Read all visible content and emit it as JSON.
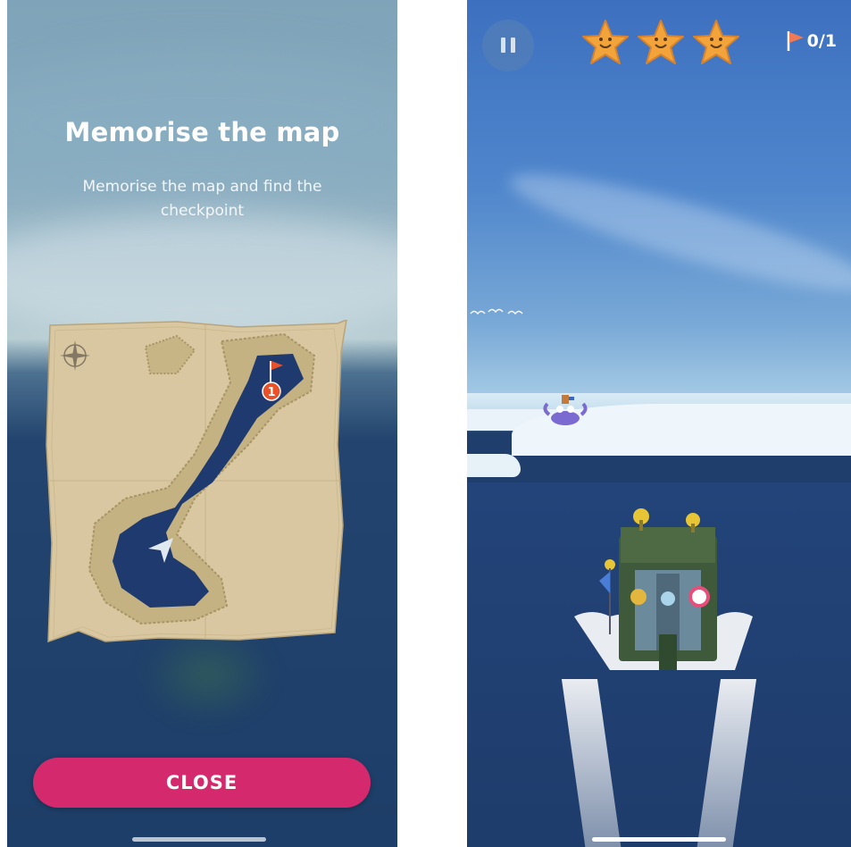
{
  "left_screen": {
    "title": "Memorise the map",
    "subtitle": "Memorise the map and find the checkpoint",
    "checkpoint_badge": "1",
    "close_label": "CLOSE"
  },
  "right_screen": {
    "stars_earned": 3,
    "checkpoint_counter": "0/1"
  },
  "colors": {
    "close_button": "#d42a6d",
    "map_paper": "#d9c9a3",
    "map_water": "#1e3a6e",
    "checkpoint_badge": "#e8512a",
    "star": "#f2a33a"
  },
  "icons": [
    "compass-rose-icon",
    "checkpoint-flag-icon",
    "player-arrow-icon",
    "pause-icon",
    "star-icon",
    "flag-icon"
  ]
}
